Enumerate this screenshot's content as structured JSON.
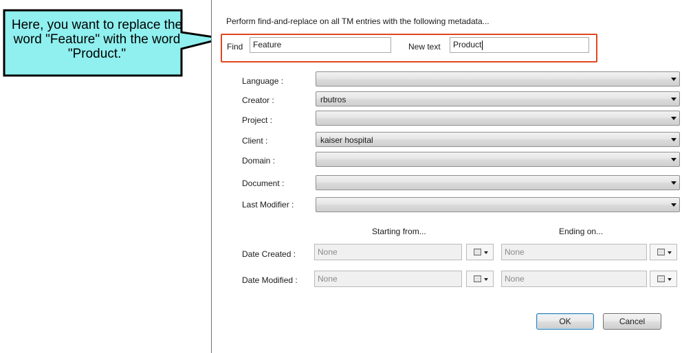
{
  "callout": {
    "text": "Here, you want to replace the word \"Feature\" with the word \"Product.\"",
    "fill": "#8ff0ef",
    "border": "#000000"
  },
  "dialog": {
    "intro": "Perform find-and-replace on all TM entries with the following metadata...",
    "highlight_color": "#e0461e",
    "find": {
      "label": "Find",
      "value": "Feature"
    },
    "new_text": {
      "label": "New text",
      "value": "Product"
    },
    "fields": [
      {
        "label": "Language :",
        "value": ""
      },
      {
        "label": "Creator :",
        "value": "rbutros"
      },
      {
        "label": "Project :",
        "value": ""
      },
      {
        "label": "Client :",
        "value": "kaiser hospital"
      },
      {
        "label": "Domain :",
        "value": ""
      },
      {
        "label": "Document :",
        "value": ""
      },
      {
        "label": "Last Modifier :",
        "value": ""
      }
    ],
    "dates": {
      "starting_header": "Starting from...",
      "ending_header": "Ending on...",
      "rows": [
        {
          "label": "Date Created :",
          "start": "None",
          "end": "None"
        },
        {
          "label": "Date Modified :",
          "start": "None",
          "end": "None"
        }
      ]
    },
    "buttons": {
      "ok": "OK",
      "cancel": "Cancel"
    }
  }
}
